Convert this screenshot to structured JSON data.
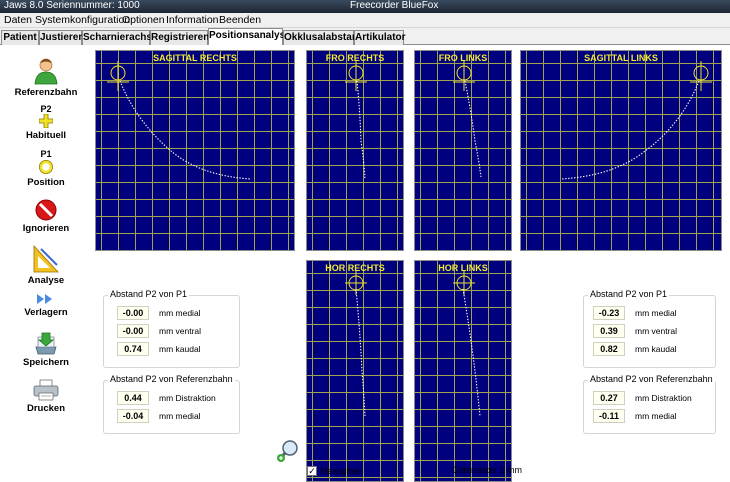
{
  "window": {
    "title": "Jaws 8.0   Seriennummer: 1000",
    "subtitle": "Freecorder BlueFox"
  },
  "menu": [
    "Daten",
    "Systemkonfiguration",
    "Optionen",
    "Information",
    "Beenden"
  ],
  "tabs": [
    "Patient",
    "Justieren",
    "Scharnierachse",
    "Registrieren",
    "Positionsanalyse",
    "Okklusalabstand",
    "Artikulator"
  ],
  "active_tab": "Positionsanalyse",
  "toolbar": {
    "referenzbahn": "Referenzbahn",
    "habituell_sup": "P2",
    "habituell": "Habituell",
    "position_sup": "P1",
    "position": "Position",
    "ignorieren": "Ignorieren",
    "analyse": "Analyse",
    "verlagern": "Verlagern",
    "speichern": "Speichern",
    "drucken": "Drucken"
  },
  "panels": {
    "sagittal_rechts": "SAGITTAL RECHTS",
    "fro_rechts": "FRO RECHTS",
    "fro_links": "FRO LINKS",
    "sagittal_links": "SAGITTAL LINKS",
    "hor_rechts": "HOR RECHTS",
    "hor_links": "HOR LINKS"
  },
  "left": {
    "p2p1_title": "Abstand P2 von P1",
    "p2p1": [
      {
        "value": "-0.00",
        "unit": "mm medial"
      },
      {
        "value": "-0.00",
        "unit": "mm ventral"
      },
      {
        "value": "0.74",
        "unit": "mm kaudal"
      }
    ],
    "ref_title": "Abstand P2 von Referenzbahn",
    "ref": [
      {
        "value": "0.44",
        "unit": "mm Distraktion"
      },
      {
        "value": "-0.04",
        "unit": "mm medial"
      }
    ]
  },
  "right": {
    "p2p1_title": "Abstand P2 von P1",
    "p2p1": [
      {
        "value": "-0.23",
        "unit": "mm medial"
      },
      {
        "value": "0.39",
        "unit": "mm ventral"
      },
      {
        "value": "0.82",
        "unit": "mm kaudal"
      }
    ],
    "ref_title": "Abstand P2 von Referenzbahn",
    "ref": [
      {
        "value": "0.27",
        "unit": "mm Distraktion"
      },
      {
        "value": "-0.11",
        "unit": "mm medial"
      }
    ]
  },
  "bottom": {
    "messgitter_label": "Messgitter",
    "messgitter_checked": "✓",
    "gitterraster": "Gitterraster 1 mm"
  },
  "colors": {
    "panel_bg": "#00007e",
    "grid": "#9ea44e",
    "panel_label": "#f2ea30"
  }
}
